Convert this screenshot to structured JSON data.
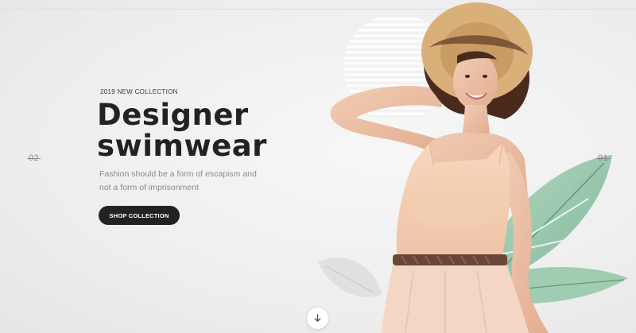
{
  "hero": {
    "eyebrow": "2019 NEW COLLECTION",
    "headline_line1": "Designer",
    "headline_line2": "swimwear",
    "tagline": "Fashion should be a form of escapism and not a form of imprisonment",
    "cta_label": "SHOP COLLECTION"
  },
  "slider": {
    "prev_number": "02",
    "next_number": "01"
  },
  "icons": {
    "scroll": "arrow-down-icon"
  },
  "colors": {
    "text_dark": "#222222",
    "text_muted": "#8a8a8a",
    "button_bg": "#222222",
    "background": "#efefef"
  }
}
